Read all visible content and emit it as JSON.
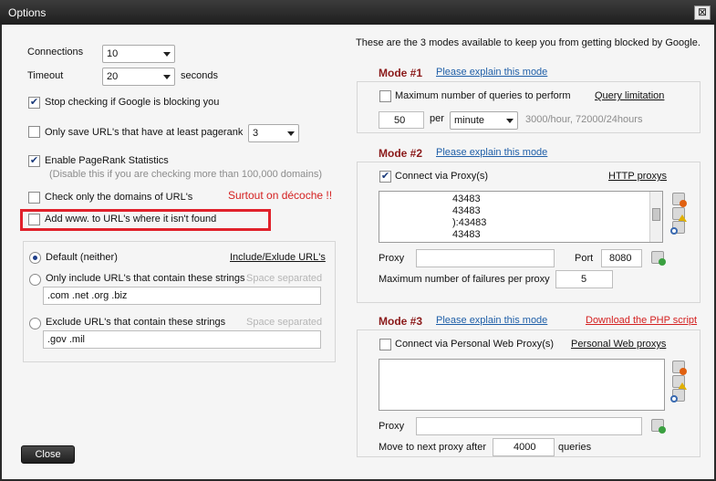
{
  "window": {
    "title": "Options",
    "close_glyph": "⊠"
  },
  "left": {
    "connections": {
      "label": "Connections",
      "value": "10"
    },
    "timeout": {
      "label": "Timeout",
      "value": "20",
      "unit": "seconds"
    },
    "stop_checking": {
      "label": "Stop checking if Google is blocking you",
      "checked": true
    },
    "only_pagerank": {
      "label": "Only save URL's that have at least pagerank",
      "checked": false,
      "value": "3"
    },
    "enable_pagerank": {
      "label": "Enable PageRank Statistics",
      "checked": true,
      "note": "(Disable this if you are checking more than 100,000 domains)"
    },
    "check_domains": {
      "label": "Check only the domains of URL's",
      "checked": false
    },
    "annotation": "Surtout on décoche !!",
    "add_www": {
      "label": "Add www. to URL's where it isn't found",
      "checked": false
    },
    "filter": {
      "link": "Include/Exlude URL's",
      "default_label": "Default (neither)",
      "include_label": "Only include URL's that contain these strings",
      "include_hint": "Space separated",
      "include_value": ".com .net .org .biz",
      "exclude_label": "Exclude URL's that contain these strings",
      "exclude_hint": "Space separated",
      "exclude_value": ".gov .mil"
    },
    "close_button": "Close"
  },
  "right": {
    "intro": "These are the 3 modes available to keep you from getting blocked by Google.",
    "mode1": {
      "title": "Mode #1",
      "explain": "Please explain this mode",
      "checkbox": "Maximum number of queries to perform",
      "checked": false,
      "link": "Query limitation",
      "queries": "50",
      "per": "per",
      "period": "minute",
      "rate_note": "3000/hour, 72000/24hours"
    },
    "mode2": {
      "title": "Mode #2",
      "explain": "Please explain this mode",
      "checkbox": "Connect via Proxy(s)",
      "checked": true,
      "link": "HTTP proxys",
      "proxies": [
        "43483",
        "43483",
        "):43483",
        "43483"
      ],
      "proxy_label": "Proxy",
      "port_label": "Port",
      "port_value": "8080",
      "failures_label": "Maximum number of failures per proxy",
      "failures_value": "5"
    },
    "mode3": {
      "title": "Mode #3",
      "explain": "Please explain this mode",
      "php_link": "Download the PHP script",
      "checkbox": "Connect via Personal Web Proxy(s)",
      "checked": false,
      "link": "Personal Web proxys",
      "proxy_label": "Proxy",
      "next_label": "Move to next proxy after",
      "next_value": "4000",
      "next_unit": "queries"
    }
  },
  "colors": {
    "accent_red": "#e0212b",
    "mode_title": "#8b1a1a",
    "link": "#1f5fa8"
  },
  "icons": [
    "close-icon",
    "checkmark-icon",
    "dropdown-arrow-icon",
    "delete-icon",
    "warning-icon",
    "search-icon",
    "add-icon"
  ]
}
